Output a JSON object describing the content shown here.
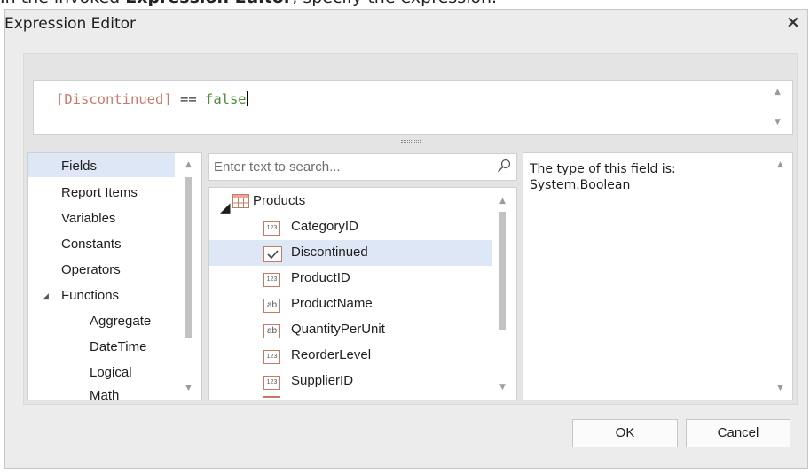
{
  "instruction": {
    "prefix": "In the invoked ",
    "bold": "Expression Editor",
    "suffix": ", specify the expression."
  },
  "dialog": {
    "title": "Expression Editor",
    "close_label": "×"
  },
  "expression": {
    "field": "[Discontinued]",
    "operator": " == ",
    "value": "false"
  },
  "categories": [
    {
      "label": "Fields",
      "selected": true
    },
    {
      "label": "Report Items"
    },
    {
      "label": "Variables"
    },
    {
      "label": "Constants"
    },
    {
      "label": "Operators"
    },
    {
      "label": "Functions",
      "expanded": true,
      "expander": "◢"
    },
    {
      "label": "Aggregate"
    },
    {
      "label": "DateTime"
    },
    {
      "label": "Logical"
    },
    {
      "label": "Math"
    }
  ],
  "search": {
    "placeholder": "Enter text to search..."
  },
  "tree": {
    "root": {
      "label": "Products",
      "expander": "◢",
      "icon": "table-icon"
    },
    "fields": [
      {
        "label": "CategoryID",
        "type": "123"
      },
      {
        "label": "Discontinued",
        "type": "bool",
        "selected": true
      },
      {
        "label": "ProductID",
        "type": "123"
      },
      {
        "label": "ProductName",
        "type": "ab"
      },
      {
        "label": "QuantityPerUnit",
        "type": "ab"
      },
      {
        "label": "ReorderLevel",
        "type": "123"
      },
      {
        "label": "SupplierID",
        "type": "123"
      }
    ]
  },
  "description": {
    "line1": "The type of this field is:",
    "line2": "System.Boolean"
  },
  "buttons": {
    "ok": "OK",
    "cancel": "Cancel"
  },
  "scroll_arrows": {
    "up": "▲",
    "down": "▼"
  },
  "colors": {
    "selection": "#dde7f5",
    "field_token": "#c97b6b",
    "keyword_token": "#4c8c3a",
    "type_icon_border": "#c37b66"
  }
}
